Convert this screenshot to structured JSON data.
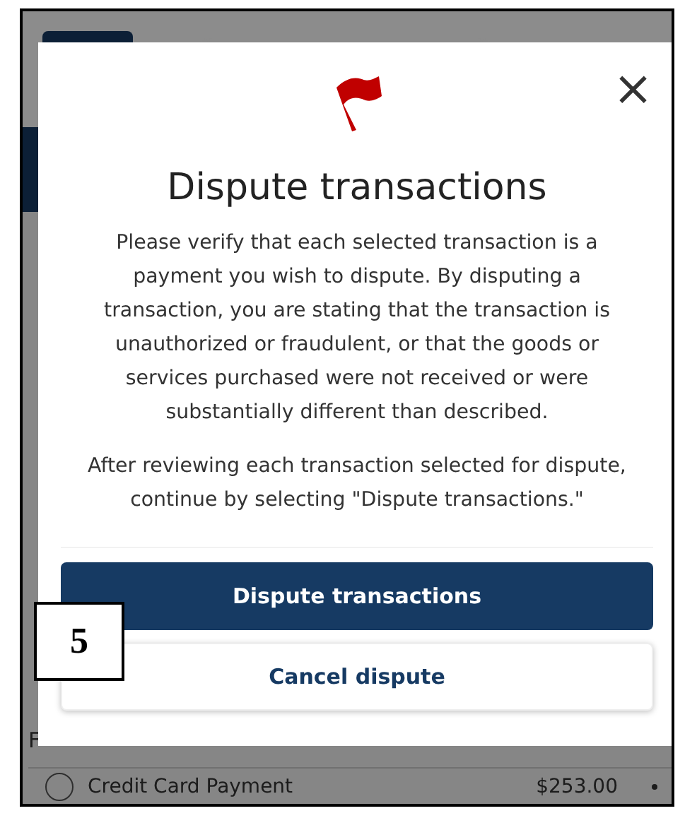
{
  "background_page": {
    "row_label_fragment": "F",
    "transaction": {
      "name": "Credit Card Payment",
      "amount": "$253.00"
    }
  },
  "dialog": {
    "close": "×",
    "title": "Dispute transactions",
    "paragraphs": [
      "Please verify that each selected transaction is a payment you wish to dispute. By disputing a transaction, you are stating that the transaction is unauthorized or fraudulent, or that the goods or services purchased were not received or were substantially different than described.",
      "After reviewing each transaction selected for dispute, continue by selecting \"Dispute transactions.\""
    ],
    "buttons": [
      {
        "kind": "primary",
        "label": "Dispute transactions"
      },
      {
        "kind": "secondary",
        "label": "Cancel dispute"
      }
    ]
  },
  "step_badge": "5"
}
